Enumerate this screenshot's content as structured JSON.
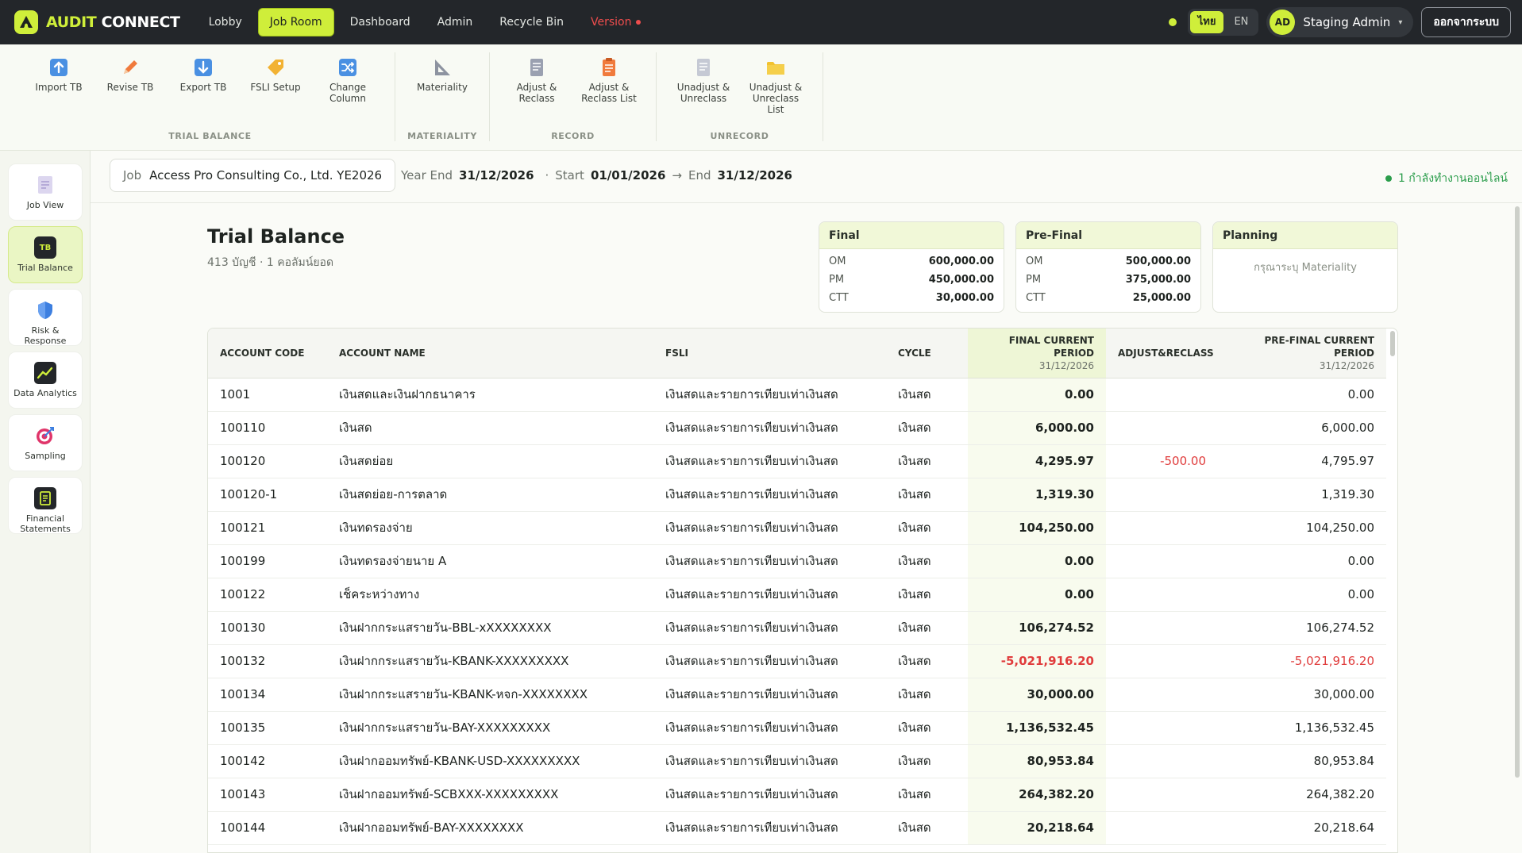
{
  "brand": {
    "part1": "AUDIT",
    "part2": "CONNECT"
  },
  "nav": {
    "lobby": "Lobby",
    "job_room": "Job Room",
    "dashboard": "Dashboard",
    "admin": "Admin",
    "recycle_bin": "Recycle Bin",
    "version": "Version"
  },
  "lang": {
    "thai": "ไทย",
    "en": "EN"
  },
  "user": {
    "initials": "AD",
    "name": "Staging Admin"
  },
  "logout_label": "ออกจากระบบ",
  "ribbon": {
    "trial_balance": {
      "title": "TRIAL BALANCE",
      "import_tb": "Import TB",
      "revise_tb": "Revise TB",
      "export_tb": "Export TB",
      "fsli_setup": "FSLI Setup",
      "change_column_1": "Change",
      "change_column_2": "Column"
    },
    "materiality": {
      "title": "MATERIALITY",
      "materiality": "Materiality"
    },
    "record": {
      "title": "RECORD",
      "adjust_reclass_1": "Adjust &",
      "adjust_reclass_2": "Reclass",
      "adjust_list_1": "Adjust &",
      "adjust_list_2": "Reclass List"
    },
    "unrecord": {
      "title": "UNRECORD",
      "unadjust_1": "Unadjust &",
      "unadjust_2": "Unreclass",
      "unadjust_list_1": "Unadjust &",
      "unadjust_list_2": "Unreclass",
      "unadjust_list_3": "List"
    }
  },
  "sidebar": {
    "job_view": "Job View",
    "trial_balance": "Trial Balance",
    "tb_badge": "TB",
    "risk_1": "Risk &",
    "risk_2": "Response",
    "data_analytics": "Data Analytics",
    "sampling": "Sampling",
    "financial_1": "Financial",
    "financial_2": "Statements"
  },
  "job": {
    "label": "Job",
    "name": "Access Pro Consulting Co., Ltd. YE2026",
    "year_end_label": "Year End",
    "year_end": "31/12/2026",
    "start_label": "Start",
    "start": "01/01/2026",
    "end_label": "End",
    "end": "31/12/2026",
    "online_status": "1 กำลังทำงานออนไลน์"
  },
  "page": {
    "title": "Trial Balance",
    "subtitle": "413 บัญชี · 1 คอลัมน์ยอด"
  },
  "materiality_cards": [
    {
      "title": "Final",
      "rows": [
        {
          "k": "OM",
          "v": "600,000.00"
        },
        {
          "k": "PM",
          "v": "450,000.00"
        },
        {
          "k": "CTT",
          "v": "30,000.00"
        }
      ]
    },
    {
      "title": "Pre-Final",
      "rows": [
        {
          "k": "OM",
          "v": "500,000.00"
        },
        {
          "k": "PM",
          "v": "375,000.00"
        },
        {
          "k": "CTT",
          "v": "25,000.00"
        }
      ]
    },
    {
      "title": "Planning",
      "empty": "กรุณาระบุ Materiality"
    }
  ],
  "table": {
    "headers": {
      "code": "ACCOUNT CODE",
      "name": "ACCOUNT NAME",
      "fsli": "FSLI",
      "cycle": "CYCLE",
      "final": "FINAL CURRENT PERIOD",
      "final_date": "31/12/2026",
      "adjust": "ADJUST&RECLASS",
      "prefinal": "PRE-FINAL CURRENT PERIOD",
      "prefinal_date": "31/12/2026"
    },
    "rows": [
      {
        "code": "1001",
        "name": "เงินสดและเงินฝากธนาคาร",
        "fsli": "เงินสดและรายการเทียบเท่าเงินสด",
        "cycle": "เงินสด",
        "final": "0.00",
        "adjust": "",
        "prefinal": "0.00"
      },
      {
        "code": "100110",
        "name": "เงินสด",
        "fsli": "เงินสดและรายการเทียบเท่าเงินสด",
        "cycle": "เงินสด",
        "final": "6,000.00",
        "adjust": "",
        "prefinal": "6,000.00"
      },
      {
        "code": "100120",
        "name": "เงินสดย่อย",
        "fsli": "เงินสดและรายการเทียบเท่าเงินสด",
        "cycle": "เงินสด",
        "final": "4,295.97",
        "adjust": "-500.00",
        "prefinal": "4,795.97"
      },
      {
        "code": "100120-1",
        "name": "เงินสดย่อย-การตลาด",
        "fsli": "เงินสดและรายการเทียบเท่าเงินสด",
        "cycle": "เงินสด",
        "final": "1,319.30",
        "adjust": "",
        "prefinal": "1,319.30"
      },
      {
        "code": "100121",
        "name": "เงินทดรองจ่าย",
        "fsli": "เงินสดและรายการเทียบเท่าเงินสด",
        "cycle": "เงินสด",
        "final": "104,250.00",
        "adjust": "",
        "prefinal": "104,250.00"
      },
      {
        "code": "100199",
        "name": "เงินทดรองจ่ายนาย A",
        "fsli": "เงินสดและรายการเทียบเท่าเงินสด",
        "cycle": "เงินสด",
        "final": "0.00",
        "adjust": "",
        "prefinal": "0.00"
      },
      {
        "code": "100122",
        "name": "เช็คระหว่างทาง",
        "fsli": "เงินสดและรายการเทียบเท่าเงินสด",
        "cycle": "เงินสด",
        "final": "0.00",
        "adjust": "",
        "prefinal": "0.00"
      },
      {
        "code": "100130",
        "name": "เงินฝากกระแสรายวัน-BBL-xXXXXXXXX",
        "fsli": "เงินสดและรายการเทียบเท่าเงินสด",
        "cycle": "เงินสด",
        "final": "106,274.52",
        "adjust": "",
        "prefinal": "106,274.52"
      },
      {
        "code": "100132",
        "name": "เงินฝากกระแสรายวัน-KBANK-XXXXXXXXX",
        "fsli": "เงินสดและรายการเทียบเท่าเงินสด",
        "cycle": "เงินสด",
        "final": "-5,021,916.20",
        "adjust": "",
        "prefinal": "-5,021,916.20"
      },
      {
        "code": "100134",
        "name": "เงินฝากกระแสรายวัน-KBANK-หจก-XXXXXXXX",
        "fsli": "เงินสดและรายการเทียบเท่าเงินสด",
        "cycle": "เงินสด",
        "final": "30,000.00",
        "adjust": "",
        "prefinal": "30,000.00"
      },
      {
        "code": "100135",
        "name": "เงินฝากกระแสรายวัน-BAY-XXXXXXXXX",
        "fsli": "เงินสดและรายการเทียบเท่าเงินสด",
        "cycle": "เงินสด",
        "final": "1,136,532.45",
        "adjust": "",
        "prefinal": "1,136,532.45"
      },
      {
        "code": "100142",
        "name": "เงินฝากออมทรัพย์-KBANK-USD-XXXXXXXXX",
        "fsli": "เงินสดและรายการเทียบเท่าเงินสด",
        "cycle": "เงินสด",
        "final": "80,953.84",
        "adjust": "",
        "prefinal": "80,953.84"
      },
      {
        "code": "100143",
        "name": "เงินฝากออมทรัพย์-SCBXXX-XXXXXXXXX",
        "fsli": "เงินสดและรายการเทียบเท่าเงินสด",
        "cycle": "เงินสด",
        "final": "264,382.20",
        "adjust": "",
        "prefinal": "264,382.20"
      },
      {
        "code": "100144",
        "name": "เงินฝากออมทรัพย์-BAY-XXXXXXXX",
        "fsli": "เงินสดและรายการเทียบเท่าเงินสด",
        "cycle": "เงินสด",
        "final": "20,218.64",
        "adjust": "",
        "prefinal": "20,218.64"
      }
    ]
  },
  "colors": {
    "accent": "#cfee3a",
    "topbar": "#23262a",
    "negative": "#e03c3c",
    "online": "#2a9d4b"
  }
}
